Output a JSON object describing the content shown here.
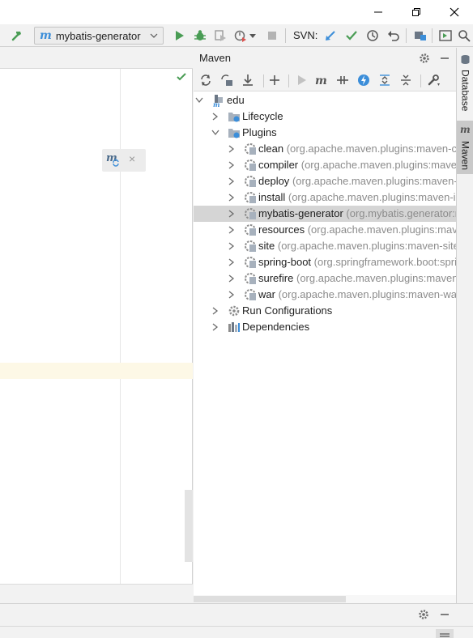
{
  "window": {
    "minimize_label": "minimize",
    "restore_label": "restore",
    "close_label": "close"
  },
  "toolbar": {
    "run_config": "mybatis-generator",
    "run_config_prefix": "m",
    "svn_label": "SVN:",
    "icons": [
      "build-hammer-icon",
      "run-icon",
      "debug-icon",
      "coverage-icon",
      "profile-icon",
      "stop-icon",
      "svn-update-icon",
      "svn-commit-icon",
      "history-icon",
      "revert-icon",
      "project-structure-icon",
      "terminal-icon",
      "search-icon"
    ]
  },
  "editor": {
    "hint_prefix": "m",
    "hint_close": "×"
  },
  "maven": {
    "title": "Maven",
    "toolbar_icons": [
      "reload-icon",
      "generate-sources-icon",
      "download-icon",
      "add-icon",
      "run-goal-icon",
      "execute-maven-goal-icon",
      "toggle-offline-icon",
      "skip-tests-icon",
      "show-dependencies-icon",
      "collapse-all-icon",
      "settings-wrench-icon"
    ],
    "tree": [
      {
        "label": "edu",
        "detail": ""
      },
      {
        "label": "Lifecycle",
        "detail": ""
      },
      {
        "label": "Plugins",
        "detail": ""
      },
      {
        "label": "clean",
        "detail": "(org.apache.maven.plugins:maven-clean-plugin"
      },
      {
        "label": "compiler",
        "detail": "(org.apache.maven.plugins:maven-compiler-plugin"
      },
      {
        "label": "deploy",
        "detail": "(org.apache.maven.plugins:maven-deploy-plugin"
      },
      {
        "label": "install",
        "detail": "(org.apache.maven.plugins:maven-install-plugin"
      },
      {
        "label": "mybatis-generator",
        "detail": "(org.mybatis.generator:mybatis-generator"
      },
      {
        "label": "resources",
        "detail": "(org.apache.maven.plugins:maven-resources-plugin"
      },
      {
        "label": "site",
        "detail": "(org.apache.maven.plugins:maven-site-plugin"
      },
      {
        "label": "spring-boot",
        "detail": "(org.springframework.boot:spring-boot"
      },
      {
        "label": "surefire",
        "detail": "(org.apache.maven.plugins:maven-surefire-plugin"
      },
      {
        "label": "war",
        "detail": "(org.apache.maven.plugins:maven-war-plugin"
      },
      {
        "label": "Run Configurations",
        "detail": ""
      },
      {
        "label": "Dependencies",
        "detail": ""
      }
    ]
  },
  "side_tabs": {
    "database": "Database",
    "maven": "Maven"
  },
  "colors": {
    "accent_blue": "#3c8ed9",
    "run_green": "#499c54",
    "selection": "#d5d5d5",
    "caret_line": "#fdf8e6"
  }
}
